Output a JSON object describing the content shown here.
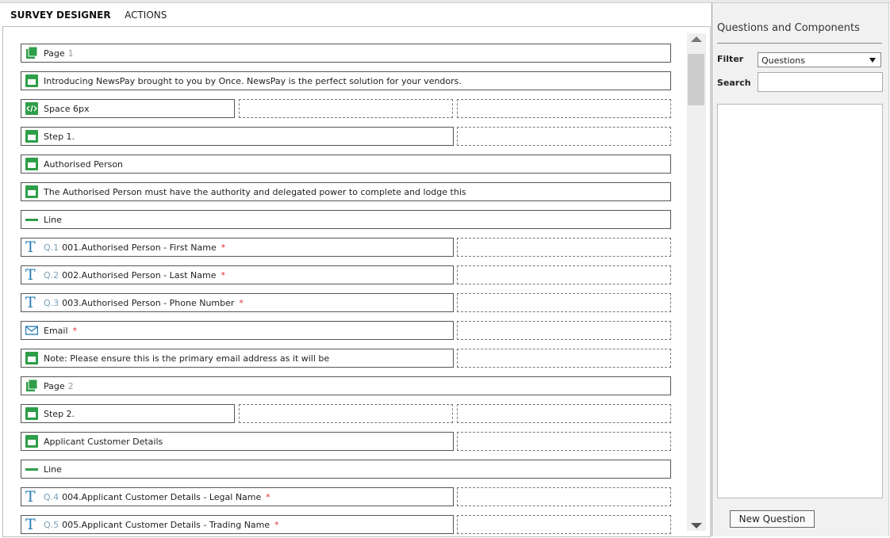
{
  "header": {
    "title": "SURVEY DESIGNER",
    "actions": "ACTIONS"
  },
  "colors": {
    "green": "#2e9e48",
    "blue": "#2a7fb8",
    "required": "#d33333"
  },
  "rows": [
    {
      "icon": "page-icon",
      "label": "Page",
      "suffix": "1"
    },
    {
      "icon": "html-block-icon",
      "label": "Introducing NewsPay brought to you by Once. NewsPay is the perfect solution for your vendors."
    },
    {
      "icon": "code-icon",
      "label": "Space 6px"
    },
    {
      "icon": "html-block-icon",
      "label": "Step 1."
    },
    {
      "icon": "html-block-icon",
      "label": "Authorised Person"
    },
    {
      "icon": "html-block-icon",
      "label": "The Authorised Person must have the authority and delegated power to complete and lodge this"
    },
    {
      "icon": "line-icon",
      "label": "Line"
    },
    {
      "icon": "text-question-icon",
      "qnum": "Q.1",
      "label": "001.Authorised Person - First Name",
      "req": "*"
    },
    {
      "icon": "text-question-icon",
      "qnum": "Q.2",
      "label": "002.Authorised Person - Last Name",
      "req": "*"
    },
    {
      "icon": "text-question-icon",
      "qnum": "Q.3",
      "label": "003.Authorised Person - Phone Number",
      "req": "*"
    },
    {
      "icon": "email-icon",
      "label": "Email",
      "req": "*"
    },
    {
      "icon": "html-block-icon",
      "label": "Note: Please ensure this is the primary email address as it will be"
    },
    {
      "icon": "page-icon",
      "label": "Page",
      "suffix": "2"
    },
    {
      "icon": "html-block-icon",
      "label": "Step 2."
    },
    {
      "icon": "html-block-icon",
      "label": "Applicant Customer Details"
    },
    {
      "icon": "line-icon",
      "label": "Line"
    },
    {
      "icon": "text-question-icon",
      "qnum": "Q.4",
      "label": "004.Applicant Customer Details - Legal Name",
      "req": "*"
    },
    {
      "icon": "text-question-icon",
      "qnum": "Q.5",
      "label": "005.Applicant Customer Details - Trading Name",
      "req": "*"
    }
  ],
  "panel": {
    "title": "Questions and Components",
    "filter_label": "Filter",
    "filter_value": "Questions",
    "search_label": "Search",
    "search_value": "",
    "new_question": "New Question"
  }
}
